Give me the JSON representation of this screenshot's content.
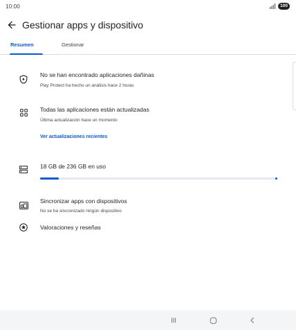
{
  "status_bar": {
    "time": "10:00",
    "battery": "100"
  },
  "header": {
    "title": "Gestionar apps y dispositivo"
  },
  "tabs": [
    {
      "label": "Resumen",
      "active": true
    },
    {
      "label": "Gestionar",
      "active": false
    }
  ],
  "rows": {
    "protect": {
      "title": "No se han encontrado aplicaciones dañinas",
      "subtitle": "Play Protect ha hecho un análisis hace 2 horas",
      "icon": "shield-icon"
    },
    "updates": {
      "title": "Todas las aplicaciones están actualizadas",
      "subtitle": "Última actualización hace un momento",
      "link": "Ver actualizaciones recientes",
      "icon": "apps-grid-icon"
    },
    "storage": {
      "title": "18 GB de 236 GB en uso",
      "used_fraction": 0.0763,
      "icon": "storage-icon"
    },
    "sync": {
      "title": "Sincronizar apps con dispositivos",
      "subtitle": "No se ha sincronizado ningún dispositivo",
      "icon": "devices-icon"
    },
    "ratings": {
      "title": "Valoraciones y reseñas",
      "icon": "star-circle-icon"
    }
  },
  "colors": {
    "accent": "#0b57d0",
    "text": "#1f1f1f",
    "subtext": "#444746",
    "divider": "#dadce0",
    "nav_bar": "#f4f5f7"
  },
  "nav_bar": {
    "buttons": [
      "recents-icon",
      "home-icon",
      "back-icon"
    ]
  }
}
